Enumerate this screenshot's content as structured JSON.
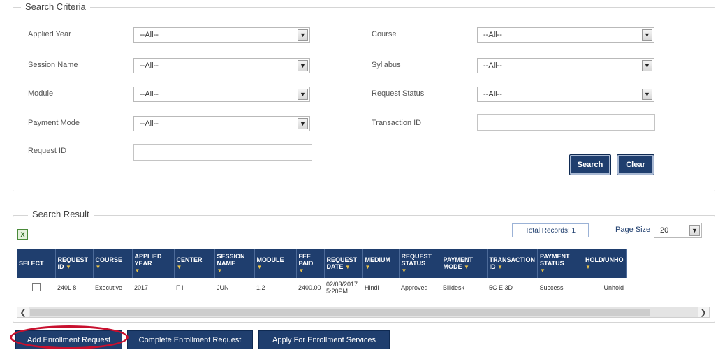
{
  "criteria": {
    "legend": "Search Criteria",
    "applied_year": {
      "label": "Applied Year",
      "value": "--All--"
    },
    "session_name": {
      "label": "Session Name",
      "value": "--All--"
    },
    "module": {
      "label": "Module",
      "value": "--All--"
    },
    "payment_mode": {
      "label": "Payment Mode",
      "value": "--All--"
    },
    "request_id": {
      "label": "Request ID",
      "value": ""
    },
    "course": {
      "label": "Course",
      "value": "--All--"
    },
    "syllabus": {
      "label": "Syllabus",
      "value": "--All--"
    },
    "request_status": {
      "label": "Request Status",
      "value": "--All--"
    },
    "transaction_id": {
      "label": "Transaction ID",
      "value": ""
    },
    "search_label": "Search",
    "clear_label": "Clear"
  },
  "result": {
    "legend": "Search Result",
    "total_records": "Total Records: 1",
    "page_size_label": "Page Size",
    "page_size_value": "20",
    "columns": [
      "SELECT",
      "REQUEST ID",
      "COURSE",
      "APPLIED YEAR",
      "CENTER",
      "SESSION NAME",
      "MODULE",
      "FEE PAID",
      "REQUEST DATE",
      "MEDIUM",
      "REQUEST STATUS",
      "PAYMENT MODE",
      "TRANSACTION ID",
      "PAYMENT STATUS",
      "HOLD/UNHO"
    ],
    "row": {
      "request_id": "240L 8",
      "course": "Executive",
      "applied_year": "2017",
      "center": "F I",
      "session_name": "JUN",
      "module": "1,2",
      "fee_paid": "2400.00",
      "request_date": "02/03/2017 5:20PM",
      "medium": "Hindi",
      "request_status": "Approved",
      "payment_mode": "Billdesk",
      "transaction_id": "5C E 3D",
      "payment_status": "Success",
      "hold": "Unhold"
    }
  },
  "actions": {
    "add_enrollment": "Add Enrollment Request",
    "complete_enrollment": "Complete Enrollment Request",
    "apply_services": "Apply For Enrollment Services"
  },
  "icons": {
    "excel": "excel-export-icon",
    "dropdown": "chevron-down-icon",
    "sort": "sort-triangle-icon"
  },
  "colors": {
    "header_bg": "#1f3e6e",
    "highlight": "#c8102e"
  }
}
